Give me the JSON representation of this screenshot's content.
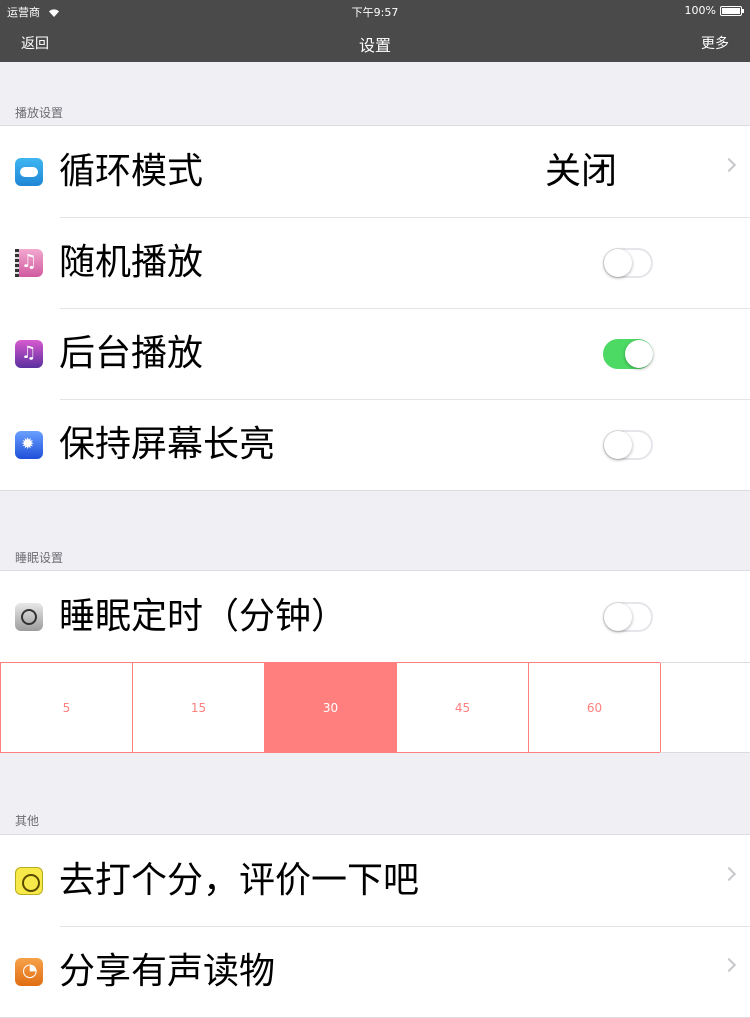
{
  "status_bar": {
    "carrier": "运营商",
    "time": "下午9:57",
    "battery": "100%"
  },
  "nav": {
    "back": "返回",
    "title": "设置",
    "more": "更多"
  },
  "sections": {
    "playback": {
      "header": "播放设置",
      "rows": [
        {
          "label": "循环模式",
          "value": "关闭",
          "icon": "loop-icon"
        },
        {
          "label": "随机播放",
          "switch_on": false,
          "icon": "shuffle-music-icon"
        },
        {
          "label": "后台播放",
          "switch_on": true,
          "icon": "music-note-icon"
        },
        {
          "label": "保持屏幕长亮",
          "switch_on": false,
          "icon": "brightness-icon"
        }
      ]
    },
    "sleep": {
      "header": "睡眠设置",
      "row": {
        "label": "睡眠定时（分钟）",
        "switch_on": false,
        "icon": "clock-icon"
      },
      "options": [
        "5",
        "15",
        "30",
        "45",
        "60"
      ],
      "selected": "30"
    },
    "other": {
      "header": "其他",
      "rows": [
        {
          "label": "去打个分，评价一下吧",
          "icon": "smiley-icon"
        },
        {
          "label": "分享有声读物",
          "icon": "share-rss-icon"
        }
      ]
    }
  },
  "colors": {
    "switch_on": "#4cd964",
    "segment_accent": "#ff7f7f",
    "nav_bg": "#4a4a4a"
  }
}
